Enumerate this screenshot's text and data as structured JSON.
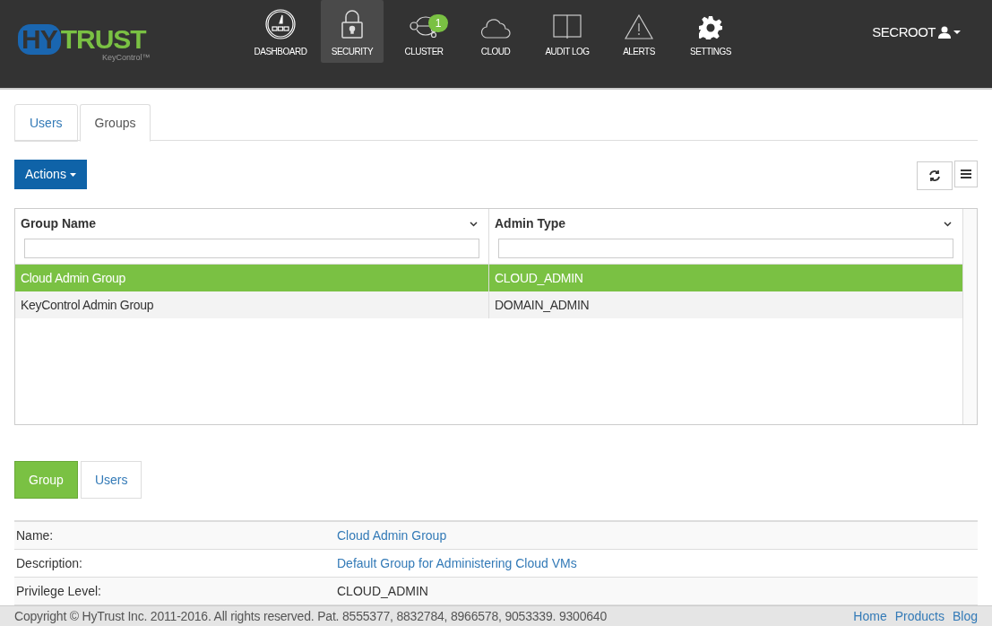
{
  "logo": {
    "word_a": "HY",
    "word_b": "TRUST",
    "product": "KeyControl™"
  },
  "nav": [
    {
      "label": "DASHBOARD",
      "selected": false
    },
    {
      "label": "SECURITY",
      "selected": true
    },
    {
      "label": "CLUSTER",
      "selected": false,
      "badge": "1"
    },
    {
      "label": "CLOUD",
      "selected": false
    },
    {
      "label": "AUDIT LOG",
      "selected": false
    },
    {
      "label": "ALERTS",
      "selected": false
    },
    {
      "label": "SETTINGS",
      "selected": false
    }
  ],
  "user": {
    "name": "SECROOT"
  },
  "tabs": [
    {
      "label": "Users",
      "selected": false
    },
    {
      "label": "Groups",
      "selected": true
    }
  ],
  "actions_button": "Actions",
  "table": {
    "columns": [
      "Group Name",
      "Admin Type"
    ],
    "rows": [
      {
        "cells": [
          "Cloud Admin Group",
          "CLOUD_ADMIN"
        ],
        "selected": true
      },
      {
        "cells": [
          "KeyControl Admin Group",
          "DOMAIN_ADMIN"
        ],
        "selected": false
      }
    ]
  },
  "detail_tabs": [
    {
      "label": "Group",
      "selected": true
    },
    {
      "label": "Users",
      "selected": false
    }
  ],
  "details": [
    {
      "label": "Name:",
      "value": "Cloud Admin Group",
      "kind": "link"
    },
    {
      "label": "Description:",
      "value": "Default Group for Administering Cloud VMs",
      "kind": "link"
    },
    {
      "label": "Privilege Level:",
      "value": "CLOUD_ADMIN",
      "kind": "text"
    }
  ],
  "footer": {
    "copyright": "Copyright © HyTrust Inc. 2011-2016. All rights reserved. Pat. 8555377, 8832784, 8966578, 9053339. 9300640",
    "links": [
      "Home",
      "Products",
      "Blog"
    ]
  }
}
